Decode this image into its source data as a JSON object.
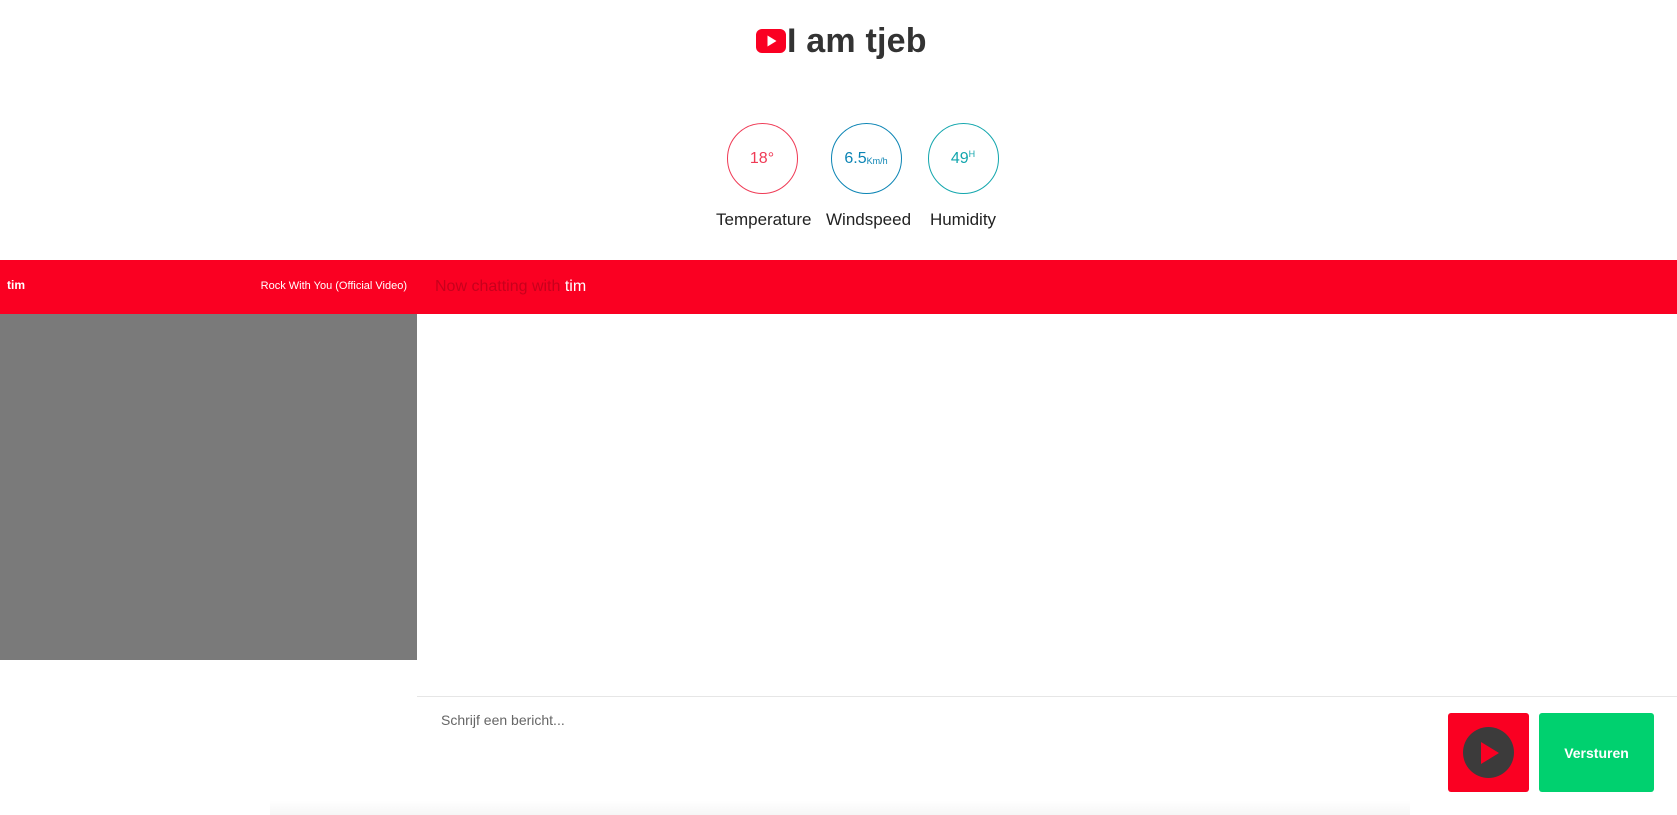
{
  "header": {
    "title": "I am tjeb",
    "icon": "youtube-icon",
    "brand_color": "#fa0022"
  },
  "weather": {
    "temperature": {
      "value": "18°",
      "label": "Temperature",
      "color": "#ef3a55"
    },
    "windspeed": {
      "value": "6.5",
      "unit": "Km/h",
      "label": "Windspeed",
      "color": "#0b84b4"
    },
    "humidity": {
      "value": "49",
      "unit": "H",
      "label": "Humidity",
      "color": "#12a6ad"
    }
  },
  "now_playing": {
    "user": "tim",
    "title": "Rock With You (Official Video)"
  },
  "chat": {
    "header_prefix": "Now chatting with",
    "partner": "tim",
    "input_placeholder": "Schrijf een bericht...",
    "input_value": "",
    "play_icon": "play-icon",
    "send_label": "Versturen",
    "send_color": "#00d16f"
  }
}
